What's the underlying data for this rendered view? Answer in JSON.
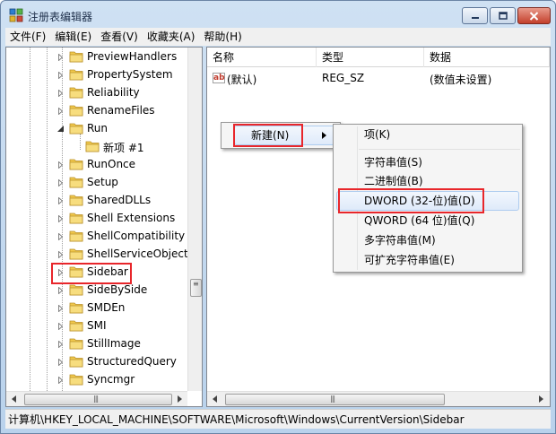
{
  "window": {
    "title": "注册表编辑器"
  },
  "menu": [
    "文件(F)",
    "编辑(E)",
    "查看(V)",
    "收藏夹(A)",
    "帮助(H)"
  ],
  "tree": {
    "items": [
      {
        "label": "PreviewHandlers",
        "expanded": false
      },
      {
        "label": "PropertySystem",
        "expanded": false
      },
      {
        "label": "Reliability",
        "expanded": false
      },
      {
        "label": "RenameFiles",
        "expanded": false
      },
      {
        "label": "Run",
        "expanded": true
      },
      {
        "label": "新项 #1",
        "child": true
      },
      {
        "label": "RunOnce",
        "expanded": false
      },
      {
        "label": "Setup",
        "expanded": false
      },
      {
        "label": "SharedDLLs",
        "expanded": false
      },
      {
        "label": "Shell Extensions",
        "expanded": false
      },
      {
        "label": "ShellCompatibility",
        "expanded": false
      },
      {
        "label": "ShellServiceObjectD",
        "expanded": false
      },
      {
        "label": "Sidebar",
        "expanded": false,
        "selected": true
      },
      {
        "label": "SideBySide",
        "expanded": false
      },
      {
        "label": "SMDEn",
        "expanded": false
      },
      {
        "label": "SMI",
        "expanded": false
      },
      {
        "label": "StillImage",
        "expanded": false
      },
      {
        "label": "StructuredQuery",
        "expanded": false
      },
      {
        "label": "Syncmgr",
        "expanded": false
      }
    ]
  },
  "list": {
    "columns": [
      "名称",
      "类型",
      "数据"
    ],
    "rows": [
      {
        "name": "(默认)",
        "type": "REG_SZ",
        "data": "(数值未设置)"
      }
    ]
  },
  "context_menu": {
    "parent_item": "新建(N)",
    "submenu": [
      {
        "label": "项(K)"
      },
      {
        "separator": true
      },
      {
        "label": "字符串值(S)"
      },
      {
        "label": "二进制值(B)"
      },
      {
        "label": "DWORD (32-位)值(D)",
        "highlighted": true
      },
      {
        "label": "QWORD (64 位)值(Q)"
      },
      {
        "label": "多字符串值(M)"
      },
      {
        "label": "可扩充字符串值(E)"
      }
    ]
  },
  "statusbar": {
    "path": "计算机\\HKEY_LOCAL_MACHINE\\SOFTWARE\\Microsoft\\Windows\\CurrentVersion\\Sidebar"
  },
  "colors": {
    "highlight_box": "#e8262b",
    "folder": "#f2c94c",
    "title_gradient_top": "#cfe1f3"
  }
}
